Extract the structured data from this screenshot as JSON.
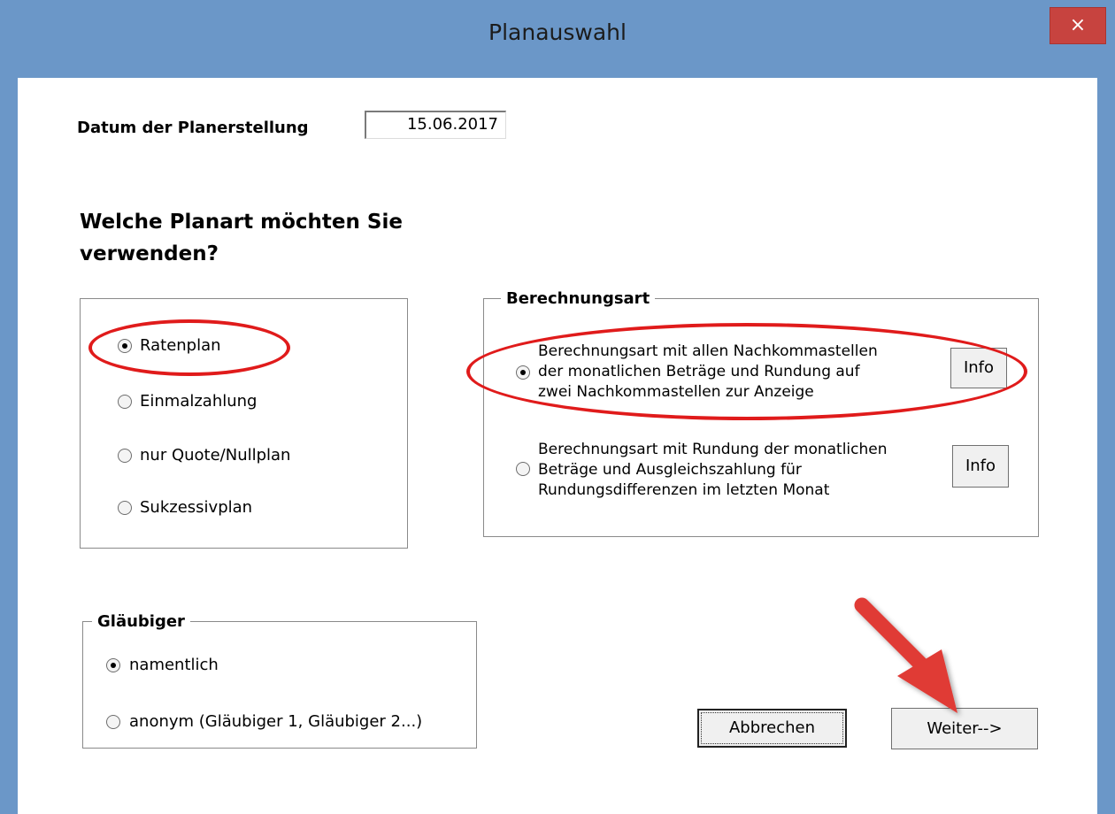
{
  "window": {
    "title": "Planauswahl",
    "close_label": "×"
  },
  "date": {
    "label": "Datum der Planerstellung",
    "value": "15.06.2017"
  },
  "question": {
    "line1": "Welche Planart möchten Sie",
    "line2": "verwenden?"
  },
  "plan_types": [
    {
      "label": "Ratenplan",
      "selected": true
    },
    {
      "label": "Einmalzahlung",
      "selected": false
    },
    {
      "label": "nur Quote/Nullplan",
      "selected": false
    },
    {
      "label": "Sukzessivplan",
      "selected": false
    }
  ],
  "berechnungsart": {
    "legend": "Berechnungsart",
    "options": [
      {
        "lines": [
          "Berechnungsart mit allen Nachkommastellen",
          "der monatlichen Beträge und Rundung auf",
          "zwei Nachkommastellen zur Anzeige"
        ],
        "selected": true,
        "info_label": "Info"
      },
      {
        "lines": [
          "Berechnungsart mit Rundung der monatlichen",
          "Beträge und Ausgleichszahlung für",
          "Rundungsdifferenzen im letzten Monat"
        ],
        "selected": false,
        "info_label": "Info"
      }
    ]
  },
  "glaeubiger": {
    "legend": "Gläubiger",
    "options": [
      {
        "label": "namentlich",
        "selected": true
      },
      {
        "label": "anonym (Gläubiger 1,  Gläubiger 2...)",
        "selected": false
      }
    ]
  },
  "buttons": {
    "cancel": "Abbrechen",
    "next": "Weiter-->"
  },
  "colors": {
    "title_bar": "#6b97c8",
    "close_button": "#c7433f",
    "annotation": "#e01b1b",
    "arrow": "#e03a36"
  }
}
